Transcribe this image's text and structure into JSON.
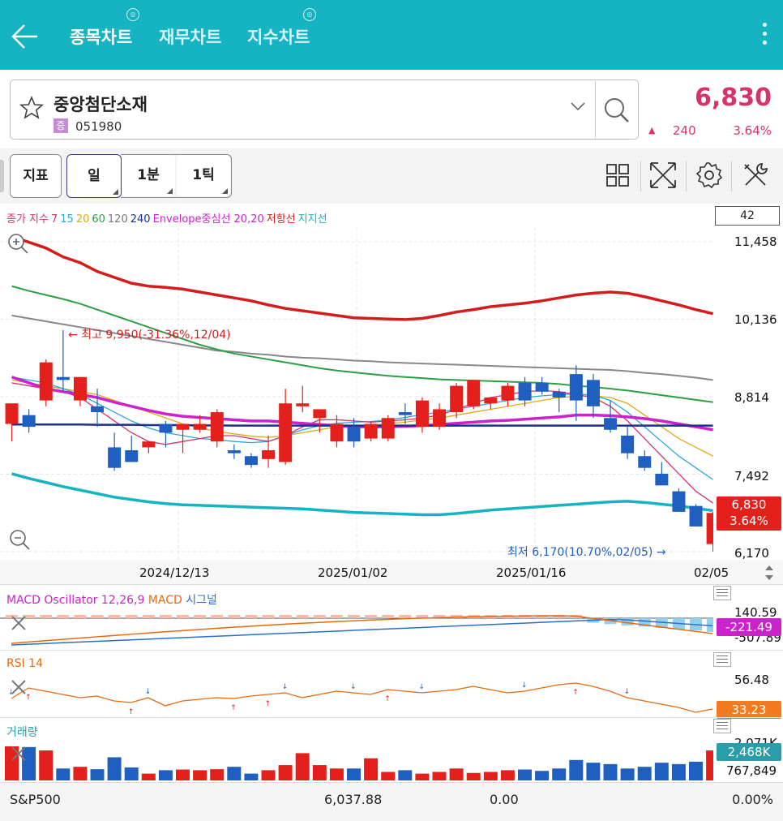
{
  "header": {
    "tabs": [
      {
        "label": "종목차트",
        "active": true,
        "badge": "◎"
      },
      {
        "label": "재무차트",
        "active": false
      },
      {
        "label": "지수차트",
        "active": false,
        "badge": "◎"
      }
    ]
  },
  "stock": {
    "name": "중앙첨단소재",
    "badge": "증",
    "code": "051980",
    "price": "6,830",
    "change_arrow": "▲",
    "change": "240",
    "change_pct": "3.64%"
  },
  "toolbar": {
    "indicator_label": "지표",
    "period_label": "일",
    "min_label": "1분",
    "tick_label": "1틱"
  },
  "legend": {
    "items": [
      {
        "text": "종가 지수",
        "color": "#d6336c"
      },
      {
        "text": "7",
        "color": "#d6336c"
      },
      {
        "text": "15",
        "color": "#2aa7d6"
      },
      {
        "text": "20",
        "color": "#e0a81a"
      },
      {
        "text": "60",
        "color": "#2e9e44"
      },
      {
        "text": "120",
        "color": "#777777"
      },
      {
        "text": "240",
        "color": "#1f2f8f"
      },
      {
        "text": "Envelope중심선 20,20",
        "color": "#cc22cc"
      },
      {
        "text": "저항선",
        "color": "#d41c1c"
      },
      {
        "text": "지지선",
        "color": "#16b3c2"
      }
    ]
  },
  "candle_count": "42",
  "chart_data": {
    "type": "candlestick",
    "y_ticks": [
      "11,458",
      "10,136",
      "8,814",
      "7,492",
      "6,170"
    ],
    "ylim": [
      6170,
      11458
    ],
    "x_ticks": [
      "2024/12/13",
      "2025/01/02",
      "2025/01/16",
      "02/05"
    ],
    "high_annotation": "최고 9,950(-31.36%,12/04)",
    "low_annotation": "최저 6,170(10.70%,02/05)",
    "last_price": "6,830",
    "last_change": "3.64%",
    "candles": [
      {
        "o": 8350,
        "h": 8550,
        "l": 8050,
        "c": 8700
      },
      {
        "o": 8500,
        "h": 8600,
        "l": 8200,
        "c": 8300
      },
      {
        "o": 8750,
        "h": 9450,
        "l": 8650,
        "c": 9400
      },
      {
        "o": 9150,
        "h": 9950,
        "l": 8900,
        "c": 9100
      },
      {
        "o": 8750,
        "h": 9150,
        "l": 8650,
        "c": 9150
      },
      {
        "o": 8650,
        "h": 8950,
        "l": 8300,
        "c": 8550
      },
      {
        "o": 7950,
        "h": 8200,
        "l": 7550,
        "c": 7600
      },
      {
        "o": 7900,
        "h": 8150,
        "l": 7700,
        "c": 7700
      },
      {
        "o": 7950,
        "h": 8000,
        "l": 7850,
        "c": 8050
      },
      {
        "o": 8350,
        "h": 8400,
        "l": 7950,
        "c": 8200
      },
      {
        "o": 8250,
        "h": 8350,
        "l": 7850,
        "c": 8350
      },
      {
        "o": 8250,
        "h": 8500,
        "l": 8200,
        "c": 8350
      },
      {
        "o": 8050,
        "h": 8600,
        "l": 7950,
        "c": 8550
      },
      {
        "o": 7900,
        "h": 8000,
        "l": 7750,
        "c": 7850
      },
      {
        "o": 7800,
        "h": 7850,
        "l": 7600,
        "c": 7650
      },
      {
        "o": 7750,
        "h": 8150,
        "l": 7600,
        "c": 7900
      },
      {
        "o": 7700,
        "h": 8950,
        "l": 7650,
        "c": 8700
      },
      {
        "o": 8650,
        "h": 9000,
        "l": 8550,
        "c": 8700
      },
      {
        "o": 8450,
        "h": 8550,
        "l": 8200,
        "c": 8600
      },
      {
        "o": 8050,
        "h": 8500,
        "l": 7950,
        "c": 8350
      },
      {
        "o": 8300,
        "h": 8450,
        "l": 7950,
        "c": 8050
      },
      {
        "o": 8100,
        "h": 8400,
        "l": 8050,
        "c": 8350
      },
      {
        "o": 8100,
        "h": 8500,
        "l": 8050,
        "c": 8450
      },
      {
        "o": 8550,
        "h": 8700,
        "l": 8350,
        "c": 8500
      },
      {
        "o": 8300,
        "h": 8800,
        "l": 8200,
        "c": 8750
      },
      {
        "o": 8300,
        "h": 8700,
        "l": 8250,
        "c": 8600
      },
      {
        "o": 8550,
        "h": 9050,
        "l": 8450,
        "c": 9000
      },
      {
        "o": 8650,
        "h": 9100,
        "l": 8600,
        "c": 9100
      },
      {
        "o": 8700,
        "h": 8800,
        "l": 8600,
        "c": 8800
      },
      {
        "o": 8750,
        "h": 9050,
        "l": 8650,
        "c": 9000
      },
      {
        "o": 9050,
        "h": 9150,
        "l": 8650,
        "c": 8750
      },
      {
        "o": 9050,
        "h": 9150,
        "l": 8850,
        "c": 8900
      },
      {
        "o": 8900,
        "h": 8950,
        "l": 8550,
        "c": 8800
      },
      {
        "o": 9200,
        "h": 9350,
        "l": 8400,
        "c": 8750
      },
      {
        "o": 9100,
        "h": 9200,
        "l": 8450,
        "c": 8650
      },
      {
        "o": 8450,
        "h": 8750,
        "l": 8200,
        "c": 8250
      },
      {
        "o": 8150,
        "h": 8300,
        "l": 7750,
        "c": 7850
      },
      {
        "o": 7800,
        "h": 7900,
        "l": 7550,
        "c": 7600
      },
      {
        "o": 7500,
        "h": 7700,
        "l": 7400,
        "c": 7300
      },
      {
        "o": 7200,
        "h": 7250,
        "l": 6900,
        "c": 6850
      },
      {
        "o": 6950,
        "h": 6980,
        "l": 6650,
        "c": 6600
      },
      {
        "o": 6300,
        "h": 6850,
        "l": 6170,
        "c": 6830
      }
    ],
    "lines": [
      {
        "name": "저항선",
        "color": "#d41c1c",
        "width": 3.5,
        "values": [
          11550,
          11450,
          11350,
          11200,
          11100,
          10950,
          10850,
          10750,
          10700,
          10680,
          10650,
          10600,
          10550,
          10500,
          10450,
          10380,
          10320,
          10280,
          10240,
          10200,
          10160,
          10150,
          10140,
          10130,
          10150,
          10200,
          10260,
          10300,
          10350,
          10380,
          10410,
          10450,
          10500,
          10550,
          10580,
          10600,
          10580,
          10520,
          10450,
          10380,
          10300,
          10230
        ]
      },
      {
        "name": "120",
        "color": "#888888",
        "width": 2,
        "values": [
          10200,
          10150,
          10100,
          10050,
          10000,
          9950,
          9900,
          9850,
          9800,
          9750,
          9700,
          9650,
          9600,
          9580,
          9550,
          9530,
          9500,
          9480,
          9470,
          9450,
          9430,
          9420,
          9400,
          9390,
          9380,
          9370,
          9360,
          9350,
          9340,
          9330,
          9320,
          9310,
          9300,
          9290,
          9280,
          9270,
          9250,
          9220,
          9200,
          9170,
          9140,
          9100
        ]
      },
      {
        "name": "60",
        "color": "#2e9e44",
        "width": 2,
        "values": [
          10700,
          10620,
          10550,
          10480,
          10400,
          10300,
          10200,
          10100,
          10000,
          9900,
          9800,
          9700,
          9620,
          9550,
          9500,
          9450,
          9400,
          9350,
          9300,
          9260,
          9230,
          9200,
          9170,
          9150,
          9130,
          9110,
          9100,
          9090,
          9080,
          9070,
          9060,
          9050,
          9030,
          9000,
          8980,
          8950,
          8920,
          8880,
          8840,
          8800,
          8760,
          8720
        ]
      },
      {
        "name": "20",
        "color": "#e0a81a",
        "width": 1.3,
        "values": [
          9100,
          9050,
          9000,
          8950,
          8900,
          8850,
          8750,
          8650,
          8550,
          8450,
          8350,
          8280,
          8220,
          8180,
          8140,
          8120,
          8150,
          8200,
          8250,
          8300,
          8320,
          8330,
          8350,
          8380,
          8420,
          8450,
          8500,
          8550,
          8600,
          8650,
          8700,
          8750,
          8800,
          8820,
          8830,
          8800,
          8700,
          8500,
          8300,
          8100,
          7950,
          7800
        ]
      },
      {
        "name": "15",
        "color": "#2aa7d6",
        "width": 1.3,
        "values": [
          9150,
          9100,
          9050,
          8950,
          8850,
          8700,
          8550,
          8400,
          8280,
          8200,
          8150,
          8100,
          8080,
          8050,
          8030,
          8050,
          8150,
          8250,
          8320,
          8360,
          8380,
          8390,
          8420,
          8460,
          8510,
          8550,
          8600,
          8650,
          8700,
          8750,
          8800,
          8830,
          8850,
          8860,
          8840,
          8750,
          8550,
          8300,
          8050,
          7800,
          7600,
          7400
        ]
      },
      {
        "name": "7",
        "color": "#d6336c",
        "width": 1.3,
        "values": [
          9050,
          9000,
          8950,
          8900,
          8800,
          8600,
          8400,
          8200,
          8050,
          8000,
          8050,
          8100,
          8150,
          8150,
          8100,
          8050,
          8150,
          8300,
          8420,
          8420,
          8400,
          8380,
          8400,
          8420,
          8450,
          8500,
          8600,
          8700,
          8800,
          8850,
          8900,
          8920,
          8900,
          8850,
          8800,
          8650,
          8400,
          8100,
          7800,
          7500,
          7200,
          7000
        ]
      },
      {
        "name": "Envelope중심선",
        "color": "#cc22cc",
        "width": 3.5,
        "values": [
          9150,
          9050,
          8950,
          8900,
          8850,
          8800,
          8720,
          8650,
          8580,
          8520,
          8480,
          8460,
          8440,
          8420,
          8400,
          8400,
          8380,
          8360,
          8340,
          8320,
          8300,
          8300,
          8300,
          8310,
          8320,
          8340,
          8360,
          8380,
          8400,
          8410,
          8430,
          8450,
          8470,
          8500,
          8500,
          8490,
          8470,
          8440,
          8400,
          8350,
          8300,
          8250
        ]
      },
      {
        "name": "240",
        "color": "#1f2f8f",
        "width": 2.5,
        "values": [
          8340,
          8340,
          8340,
          8340,
          8340,
          8335,
          8335,
          8335,
          8330,
          8330,
          8330,
          8325,
          8325,
          8320,
          8320,
          8320,
          8320,
          8320,
          8320,
          8320,
          8320,
          8320,
          8320,
          8320,
          8320,
          8320,
          8320,
          8320,
          8320,
          8320,
          8320,
          8320,
          8320,
          8320,
          8320,
          8320,
          8320,
          8320,
          8320,
          8320,
          8320,
          8320
        ]
      },
      {
        "name": "지지선",
        "color": "#16b3c2",
        "width": 3.5,
        "values": [
          7500,
          7420,
          7350,
          7280,
          7220,
          7160,
          7100,
          7060,
          7020,
          6990,
          6970,
          6960,
          6950,
          6940,
          6930,
          6920,
          6910,
          6900,
          6880,
          6860,
          6840,
          6830,
          6820,
          6810,
          6800,
          6800,
          6820,
          6850,
          6880,
          6900,
          6920,
          6940,
          6960,
          6980,
          7000,
          7020,
          7030,
          7010,
          6980,
          6950,
          6910,
          6870
        ]
      }
    ]
  },
  "macd": {
    "title_osc": "MACD Oscillator 12,26,9",
    "title_macd": "MACD",
    "title_signal": "시그널",
    "top_value": "140.59",
    "bottom_value": "-507.89",
    "current": "-221.49"
  },
  "rsi": {
    "title": "RSI 14",
    "top_value": "56.48",
    "current": "33.23"
  },
  "volume": {
    "title": "거래량",
    "top_value": "2,071K",
    "current": "2,468K",
    "low_value": "767,849",
    "bars": [
      1.0,
      0.98,
      0.88,
      0.35,
      0.4,
      0.33,
      0.68,
      0.38,
      0.2,
      0.3,
      0.32,
      0.3,
      0.33,
      0.4,
      0.2,
      0.3,
      0.45,
      0.8,
      0.45,
      0.35,
      0.35,
      0.65,
      0.25,
      0.3,
      0.2,
      0.25,
      0.35,
      0.22,
      0.25,
      0.3,
      0.32,
      0.28,
      0.35,
      0.6,
      0.52,
      0.48,
      0.35,
      0.4,
      0.52,
      0.48,
      0.55,
      0.88
    ]
  },
  "footer": {
    "index_name": "S&P500",
    "index_value": "6,037.88",
    "index_change": "0.00",
    "index_pct": "0.00%"
  }
}
